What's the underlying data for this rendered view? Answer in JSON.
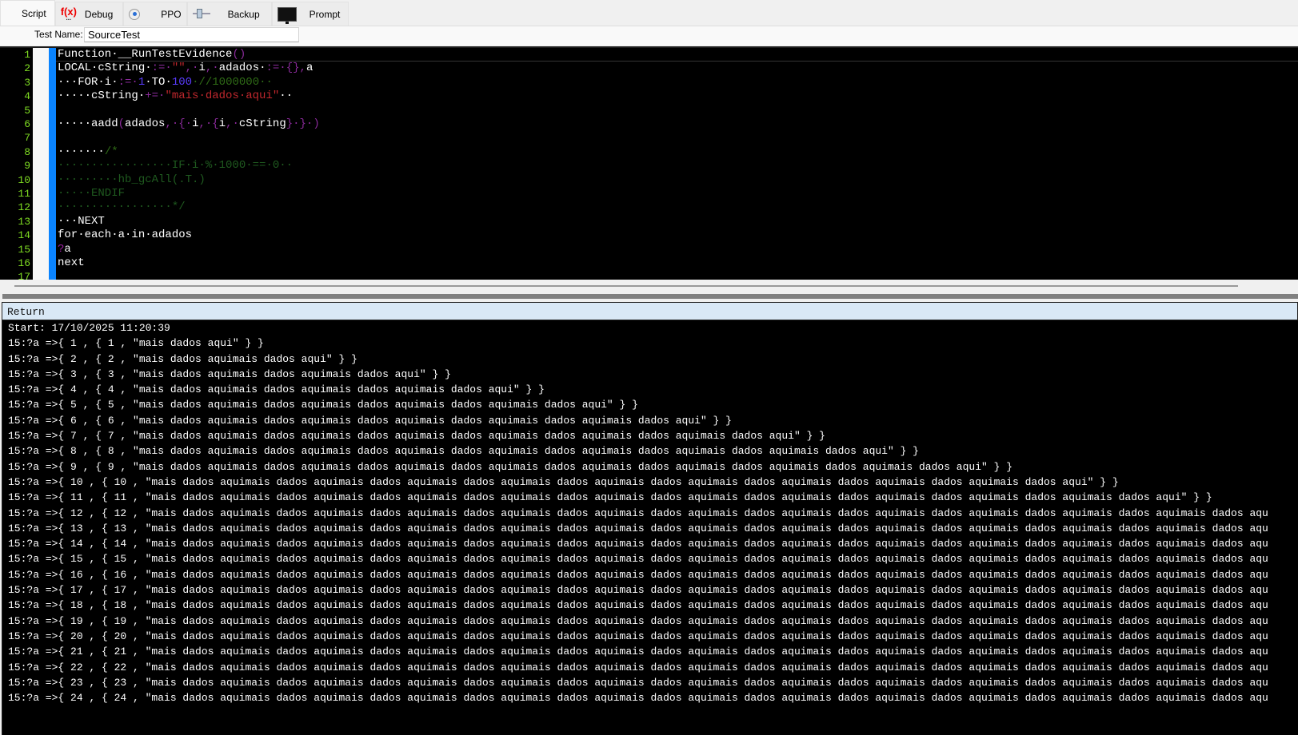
{
  "tabs": [
    {
      "label": "Script",
      "icon": "none",
      "active": true
    },
    {
      "label": "Debug",
      "icon": "function-icon"
    },
    {
      "label": "PPO",
      "icon": "target-icon"
    },
    {
      "label": "Backup",
      "icon": "slider-icon"
    },
    {
      "label": "Prompt",
      "icon": "monitor-icon"
    }
  ],
  "fx_label": "f(x)",
  "test_name": {
    "label": "Test Name:",
    "value": "SourceTest"
  },
  "editor": {
    "line_numbers": [
      "1",
      "2",
      "3",
      "4",
      "5",
      "6",
      "7",
      "8",
      "9",
      "10",
      "11",
      "12",
      "13",
      "14",
      "15",
      "16",
      "17"
    ],
    "lines": [
      [
        [
          "Function·__RunTestEvidence",
          "w"
        ],
        [
          "()",
          "p"
        ]
      ],
      [
        [
          "LOCAL·cString·",
          "w"
        ],
        [
          ":=·",
          "p"
        ],
        [
          "\"\"",
          "r"
        ],
        [
          ",·",
          "p"
        ],
        [
          "i",
          "w"
        ],
        [
          ",·",
          "p"
        ],
        [
          "adados·",
          "w"
        ],
        [
          ":=·",
          "p"
        ],
        [
          "{},",
          "p"
        ],
        [
          "a",
          "w"
        ]
      ],
      [
        [
          "···FOR·i·",
          "w"
        ],
        [
          ":=·",
          "p"
        ],
        [
          "1",
          "b"
        ],
        [
          "·TO·",
          "w"
        ],
        [
          "100",
          "b"
        ],
        [
          "·//1000000··",
          "g"
        ]
      ],
      [
        [
          "·····cString·",
          "w"
        ],
        [
          "+=·",
          "p"
        ],
        [
          "\"mais·dados·aqui\"",
          "r"
        ],
        [
          "··",
          "w"
        ]
      ],
      [],
      [
        [
          "·····aadd",
          "w"
        ],
        [
          "(",
          "p"
        ],
        [
          "adados",
          "w"
        ],
        [
          ",·{·",
          "p"
        ],
        [
          "i",
          "w"
        ],
        [
          ",·{",
          "p"
        ],
        [
          "i",
          "w"
        ],
        [
          ",·",
          "p"
        ],
        [
          "cString",
          "w"
        ],
        [
          "}·}·)",
          "p"
        ]
      ],
      [],
      [
        [
          "·······",
          "w"
        ],
        [
          "/*",
          "g"
        ]
      ],
      [
        [
          "·················IF·i·%·1000·==·0··",
          "c"
        ]
      ],
      [
        [
          "·········hb_gcAll(.T.)",
          "c"
        ]
      ],
      [
        [
          "·····ENDIF",
          "c"
        ]
      ],
      [
        [
          "·················*/",
          "c"
        ]
      ],
      [
        [
          "···NEXT",
          "w"
        ]
      ],
      [
        [
          "for·each·a·in·adados",
          "w"
        ]
      ],
      [
        [
          "?",
          "q"
        ],
        [
          "a",
          "w"
        ]
      ],
      [
        [
          "next",
          "w"
        ]
      ],
      []
    ]
  },
  "output": {
    "header": "Return",
    "lines": [
      "Start: 17/10/2025 11:20:39",
      "15:?a =>{ 1 , { 1 , \"mais dados aqui\" } }",
      "15:?a =>{ 2 , { 2 , \"mais dados aquimais dados aqui\" } }",
      "15:?a =>{ 3 , { 3 , \"mais dados aquimais dados aquimais dados aqui\" } }",
      "15:?a =>{ 4 , { 4 , \"mais dados aquimais dados aquimais dados aquimais dados aqui\" } }",
      "15:?a =>{ 5 , { 5 , \"mais dados aquimais dados aquimais dados aquimais dados aquimais dados aqui\" } }",
      "15:?a =>{ 6 , { 6 , \"mais dados aquimais dados aquimais dados aquimais dados aquimais dados aquimais dados aqui\" } }",
      "15:?a =>{ 7 , { 7 , \"mais dados aquimais dados aquimais dados aquimais dados aquimais dados aquimais dados aquimais dados aqui\" } }",
      "15:?a =>{ 8 , { 8 , \"mais dados aquimais dados aquimais dados aquimais dados aquimais dados aquimais dados aquimais dados aquimais dados aqui\" } }",
      "15:?a =>{ 9 , { 9 , \"mais dados aquimais dados aquimais dados aquimais dados aquimais dados aquimais dados aquimais dados aquimais dados aquimais dados aqui\" } }",
      "15:?a =>{ 10 , { 10 , \"mais dados aquimais dados aquimais dados aquimais dados aquimais dados aquimais dados aquimais dados aquimais dados aquimais dados aquimais dados aqui\" } }",
      "15:?a =>{ 11 , { 11 , \"mais dados aquimais dados aquimais dados aquimais dados aquimais dados aquimais dados aquimais dados aquimais dados aquimais dados aquimais dados aquimais dados aqui\" } }",
      "15:?a =>{ 12 , { 12 , \"mais dados aquimais dados aquimais dados aquimais dados aquimais dados aquimais dados aquimais dados aquimais dados aquimais dados aquimais dados aquimais dados aquimais dados aqu",
      "15:?a =>{ 13 , { 13 , \"mais dados aquimais dados aquimais dados aquimais dados aquimais dados aquimais dados aquimais dados aquimais dados aquimais dados aquimais dados aquimais dados aquimais dados aqu",
      "15:?a =>{ 14 , { 14 , \"mais dados aquimais dados aquimais dados aquimais dados aquimais dados aquimais dados aquimais dados aquimais dados aquimais dados aquimais dados aquimais dados aquimais dados aqu",
      "15:?a =>{ 15 , { 15 , \"mais dados aquimais dados aquimais dados aquimais dados aquimais dados aquimais dados aquimais dados aquimais dados aquimais dados aquimais dados aquimais dados aquimais dados aqu",
      "15:?a =>{ 16 , { 16 , \"mais dados aquimais dados aquimais dados aquimais dados aquimais dados aquimais dados aquimais dados aquimais dados aquimais dados aquimais dados aquimais dados aquimais dados aqu",
      "15:?a =>{ 17 , { 17 , \"mais dados aquimais dados aquimais dados aquimais dados aquimais dados aquimais dados aquimais dados aquimais dados aquimais dados aquimais dados aquimais dados aquimais dados aqu",
      "15:?a =>{ 18 , { 18 , \"mais dados aquimais dados aquimais dados aquimais dados aquimais dados aquimais dados aquimais dados aquimais dados aquimais dados aquimais dados aquimais dados aquimais dados aqu",
      "15:?a =>{ 19 , { 19 , \"mais dados aquimais dados aquimais dados aquimais dados aquimais dados aquimais dados aquimais dados aquimais dados aquimais dados aquimais dados aquimais dados aquimais dados aqu",
      "15:?a =>{ 20 , { 20 , \"mais dados aquimais dados aquimais dados aquimais dados aquimais dados aquimais dados aquimais dados aquimais dados aquimais dados aquimais dados aquimais dados aquimais dados aqu",
      "15:?a =>{ 21 , { 21 , \"mais dados aquimais dados aquimais dados aquimais dados aquimais dados aquimais dados aquimais dados aquimais dados aquimais dados aquimais dados aquimais dados aquimais dados aqu",
      "15:?a =>{ 22 , { 22 , \"mais dados aquimais dados aquimais dados aquimais dados aquimais dados aquimais dados aquimais dados aquimais dados aquimais dados aquimais dados aquimais dados aquimais dados aqu",
      "15:?a =>{ 23 , { 23 , \"mais dados aquimais dados aquimais dados aquimais dados aquimais dados aquimais dados aquimais dados aquimais dados aquimais dados aquimais dados aquimais dados aquimais dados aqu",
      "15:?a =>{ 24 , { 24 , \"mais dados aquimais dados aquimais dados aquimais dados aquimais dados aquimais dados aquimais dados aquimais dados aquimais dados aquimais dados aquimais dados aquimais dados aqu"
    ]
  },
  "colors": {
    "gutter_numbers": "#7fdd22",
    "margin_bar": "#0a84ff",
    "return_header": "#d9e8f6"
  }
}
